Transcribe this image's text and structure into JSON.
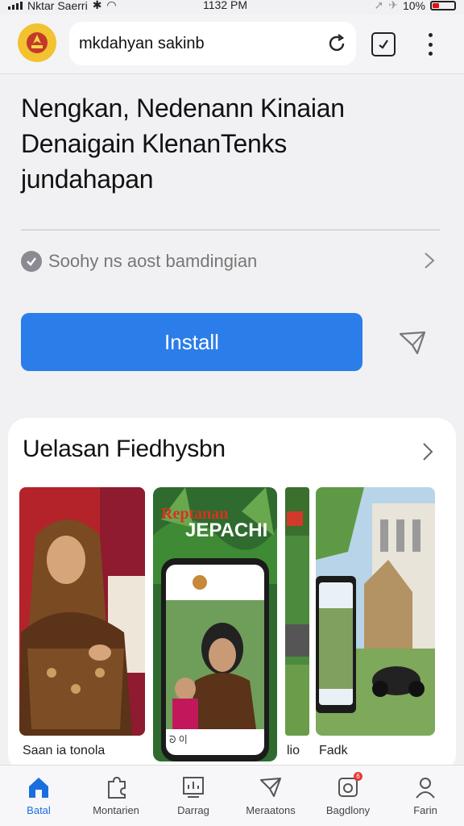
{
  "status_bar": {
    "carrier": "Nktar Saerri",
    "time": "1132 PM",
    "battery": "10%"
  },
  "browser": {
    "url": "mkdahyan sakinb"
  },
  "app": {
    "headline_lines": [
      "Nengkan, Nedenann Kinaian",
      "Denaigain KlenanTenks",
      "jundahapan"
    ],
    "info_text": "Soohy ns aost bamdingian",
    "install_label": "Install"
  },
  "screenshots": {
    "title": "Uelasan Fiedhysbn",
    "overlay_title_1": "Reptanan",
    "overlay_title_2": "JEPACHI",
    "phone_nav_left": "ᘐ 이",
    "captions": [
      "Saan ia tonola",
      "lio",
      "Fadk"
    ]
  },
  "nav": [
    {
      "label": "Batal",
      "icon": "home-icon",
      "active": true
    },
    {
      "label": "Montarien",
      "icon": "puzzle-icon",
      "active": false
    },
    {
      "label": "Darrag",
      "icon": "chart-icon",
      "active": false
    },
    {
      "label": "Meraatons",
      "icon": "send-icon",
      "active": false
    },
    {
      "label": "Bagdlony",
      "icon": "notification-icon",
      "active": false,
      "badge": "6"
    },
    {
      "label": "Farin",
      "icon": "profile-icon",
      "active": false
    }
  ],
  "colors": {
    "accent": "#2b7de9",
    "nav_active": "#1a6fe0",
    "logo": "#f2c230",
    "badge": "#e53935"
  }
}
